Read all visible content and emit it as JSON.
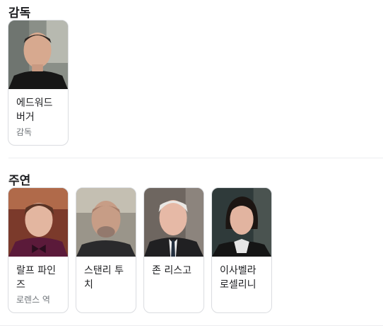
{
  "sections": {
    "director": {
      "title": "감독",
      "people": [
        {
          "name_line1": "에드워드",
          "name_line2": "버거",
          "role": "감독"
        }
      ]
    },
    "cast": {
      "title": "주연",
      "people": [
        {
          "name_line1": "랄프 파인",
          "name_line2": "즈",
          "role": "로렌스 역"
        },
        {
          "name_line1": "스탠리 투",
          "name_line2": "치",
          "role": ""
        },
        {
          "name_line1": "존 리스고",
          "name_line2": "",
          "role": ""
        },
        {
          "name_line1": "이사벨라",
          "name_line2": "로셀리니",
          "role": ""
        }
      ]
    }
  }
}
